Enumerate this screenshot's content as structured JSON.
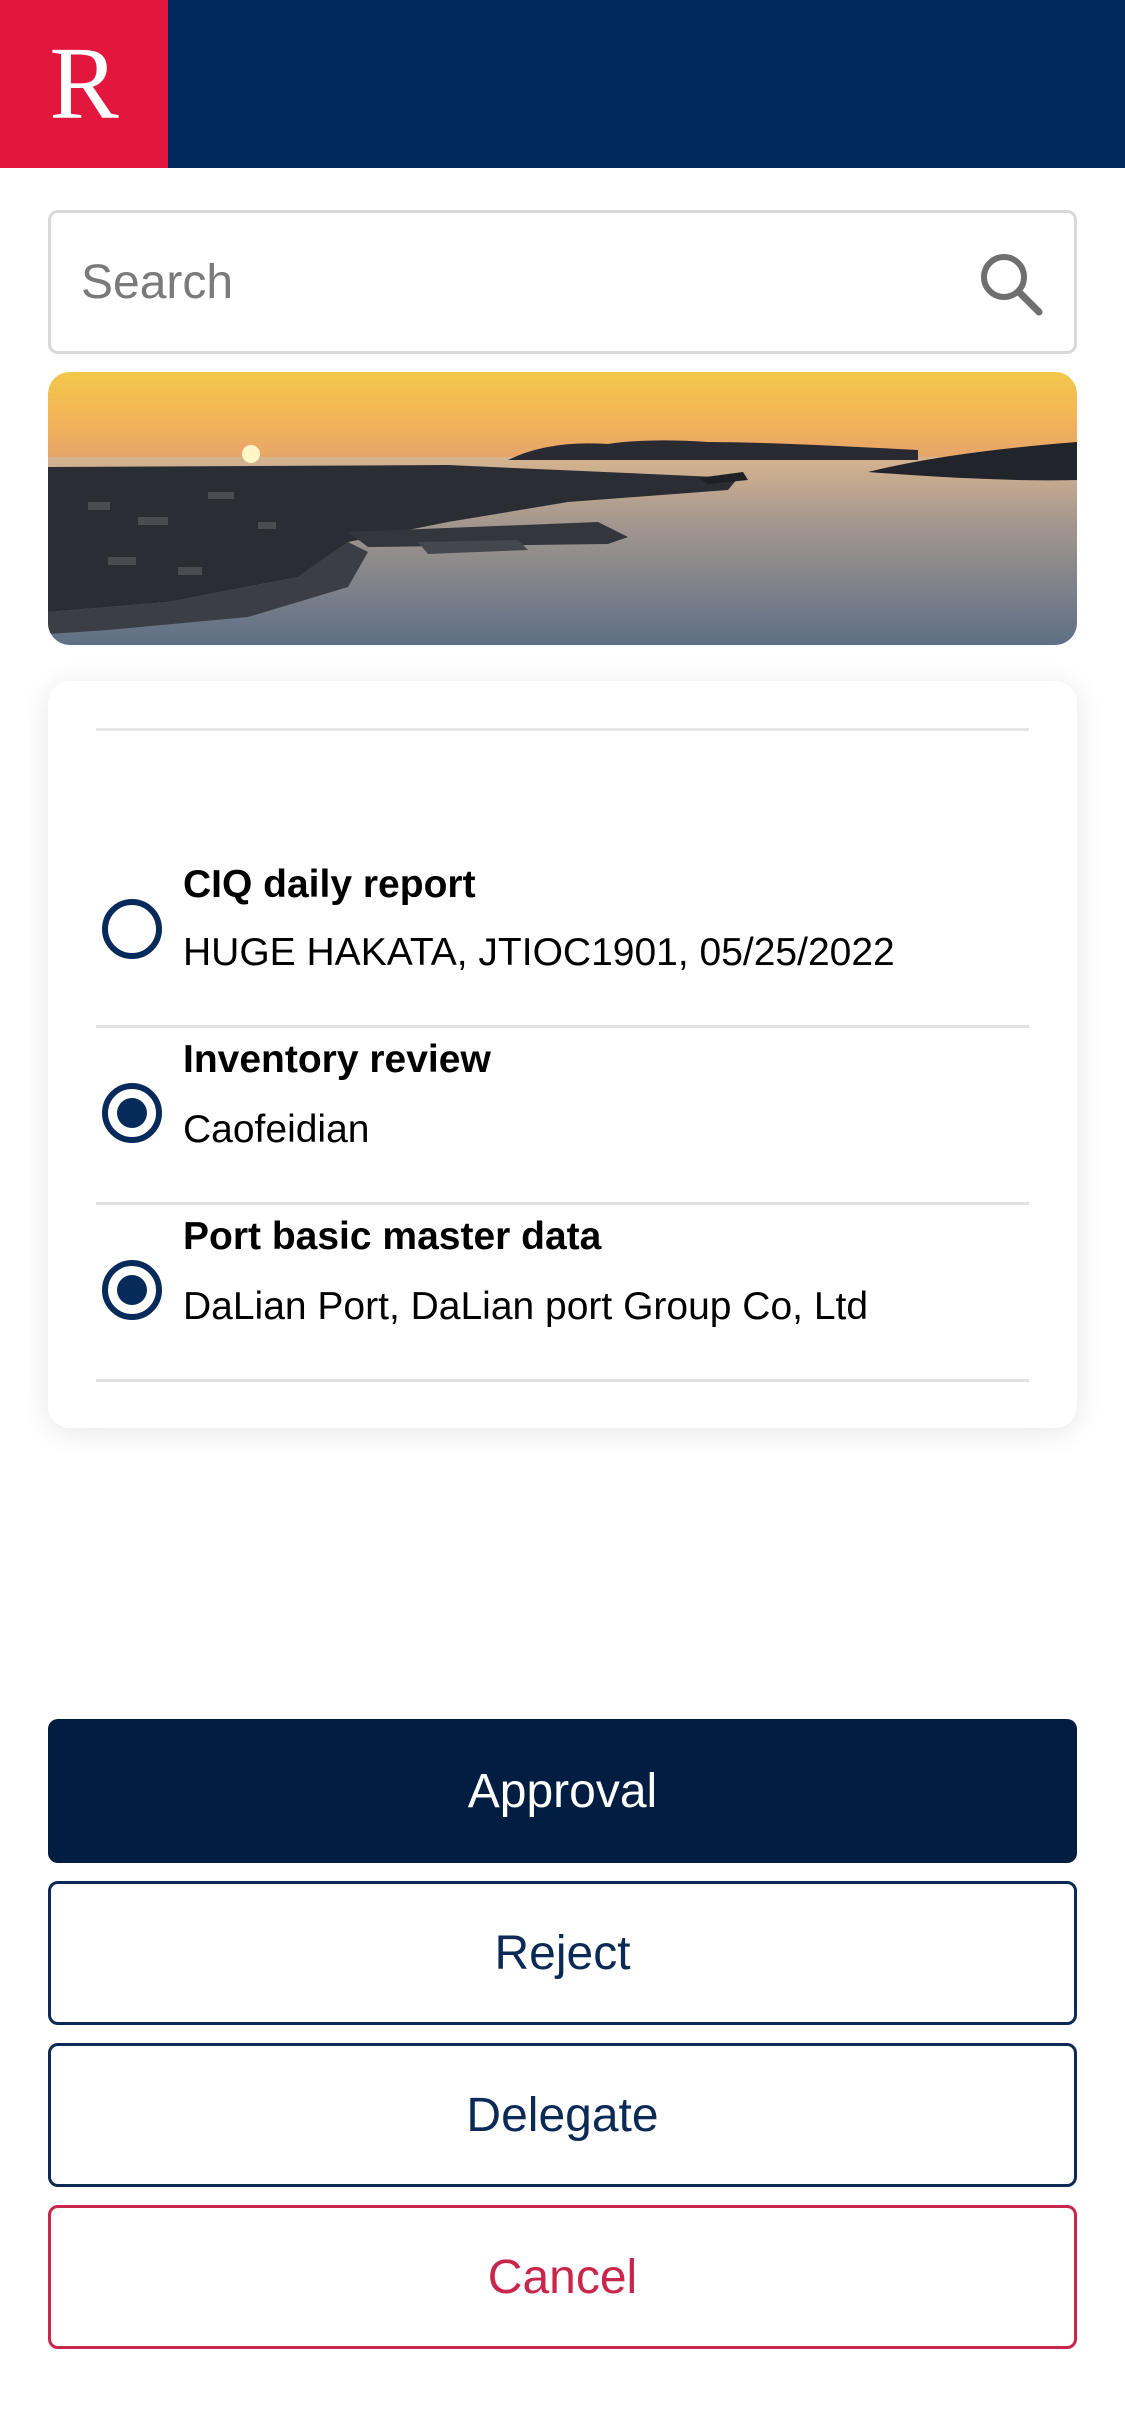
{
  "header": {
    "logo_letter": "R",
    "brand_color": "#e3173e",
    "bar_color": "#002a5c"
  },
  "search": {
    "placeholder": "Search",
    "icon": "search-icon"
  },
  "banner": {
    "description_icon": "harbor-sunset-image"
  },
  "list": {
    "items": [
      {
        "title": "CIQ daily report",
        "subtitle": "HUGE HAKATA, JTIOC1901, 05/25/2022",
        "selected": false
      },
      {
        "title": "Inventory review",
        "subtitle": "Caofeidian",
        "selected": true
      },
      {
        "title": "Port basic master data",
        "subtitle": "DaLian Port, DaLian port Group Co, Ltd",
        "selected": true
      }
    ]
  },
  "actions": {
    "approve_label": "Approval",
    "reject_label": "Reject",
    "delegate_label": "Delegate",
    "cancel_label": "Cancel",
    "primary_color": "#021d42",
    "danger_color": "#c8264b"
  }
}
